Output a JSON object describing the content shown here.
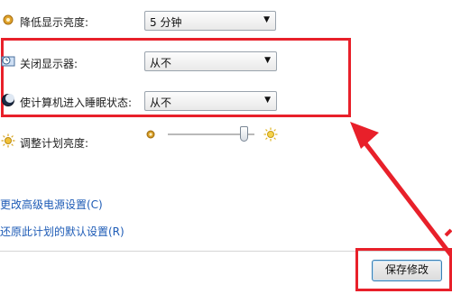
{
  "settings": {
    "dim_display": {
      "label": "降低显示亮度:",
      "value": "5 分钟"
    },
    "turn_off_display": {
      "label": "关闭显示器:",
      "value": "从不"
    },
    "sleep": {
      "label": "使计算机进入睡眠状态:",
      "value": "从不"
    },
    "brightness": {
      "label": "调整计划亮度:",
      "level": 0.88
    }
  },
  "links": {
    "advanced": "更改高级电源设置(C)",
    "restore": "还原此计划的默认设置(R)"
  },
  "buttons": {
    "save": "保存修改"
  },
  "icons": {
    "dim": "dim-brightness-icon",
    "monitor": "monitor-clock-icon",
    "sleep": "moon-sleep-icon",
    "brightness": "sun-icon",
    "slider_low": "low-brightness-icon",
    "slider_high": "high-brightness-icon"
  },
  "colors": {
    "annotation": "#e8202a",
    "link": "#1d5bb6"
  }
}
